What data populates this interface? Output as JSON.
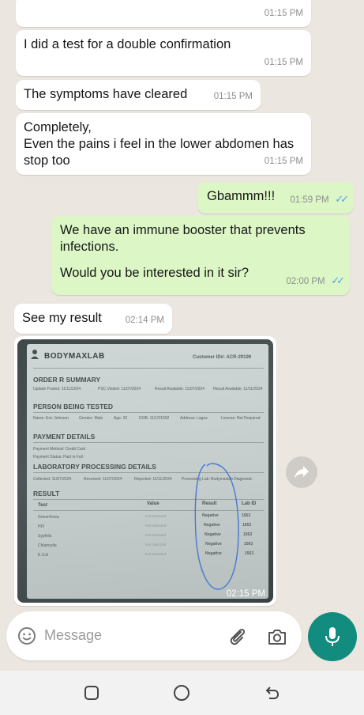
{
  "messages": [
    {
      "text": "",
      "time": "01:15 PM"
    },
    {
      "text": "I did a test for a double confirmation",
      "time": "01:15 PM"
    },
    {
      "text": "The symptoms have cleared",
      "time": "01:15 PM"
    },
    {
      "line1": "Completely,",
      "line2": "Even the pains i feel in the lower abdomen has",
      "line3": "stop too",
      "time": "01:15 PM"
    },
    {
      "text": "Gbammm!!!",
      "time": "01:59 PM"
    },
    {
      "line1": "We have an immune booster that prevents",
      "line2": "infections.",
      "line3": "Would you be interested in it sir?",
      "time": "02:00 PM"
    },
    {
      "text": "See my result",
      "time": "02:14 PM"
    }
  ],
  "image_message": {
    "time": "02:15 PM",
    "document": {
      "lab_name": "BODYMAXLAB",
      "customer_id": "Customer ID#: ACR-29199",
      "section_order": "ORDER R SUMMARY",
      "order_fields": [
        "Update Posted: 11/11/2024",
        "PSC Visited: 11/07/2024",
        "Result Available: 11/07/2024",
        "Result Available: 11/11/2024"
      ],
      "section_person": "PERSON BEING TESTED",
      "person_fields": [
        "Name: Eric Johnson",
        "Gender: Male",
        "Age: 32",
        "DOB: 11/12/1992",
        "Address: Lagos",
        "License: Not Required"
      ],
      "section_payment": "PAYMENT DETAILS",
      "payment_fields": [
        "Payment Method: Credit Card",
        "Payment Status: Paid in Full"
      ],
      "section_lab": "LABORATORY PROCESSING DETAILS",
      "lab_fields": [
        "Collected: 11/07/2024",
        "Received: 11/07/2024",
        "Reported: 11/11/2024",
        "Processing Lab: Bodymaxlab Diagnostic"
      ],
      "section_result": "RESULT",
      "columns": [
        "Test",
        "Value",
        "Result",
        "Lab ID"
      ],
      "rows": [
        {
          "test": "Gonorrhoea",
          "value": "Not Detected",
          "result": "Negative",
          "lab": "1563"
        },
        {
          "test": "HIV",
          "value": "Not Detected",
          "result": "Negative",
          "lab": "1563"
        },
        {
          "test": "Syphilis",
          "value": "Not Detected",
          "result": "Negative",
          "lab": "1563"
        },
        {
          "test": "Chlamydia",
          "value": "Not Detected",
          "result": "Negative",
          "lab": "1563"
        },
        {
          "test": "E.Coli",
          "value": "Not Detected",
          "result": "Negative",
          "lab": "1563"
        }
      ]
    }
  },
  "composer": {
    "placeholder": "Message"
  },
  "icons": {
    "emoji": "emoji-icon",
    "attach": "paperclip-icon",
    "camera": "camera-icon",
    "mic": "microphone-icon",
    "forward": "forward-icon",
    "read_ticks": "double-check-icon",
    "nav_recents": "recents-icon",
    "nav_home": "home-icon",
    "nav_back": "back-icon"
  },
  "colors": {
    "incoming_bubble": "#ffffff",
    "outgoing_bubble": "#dcf7c5",
    "accent": "#128c7e",
    "ticks": "#4fa3e6"
  }
}
